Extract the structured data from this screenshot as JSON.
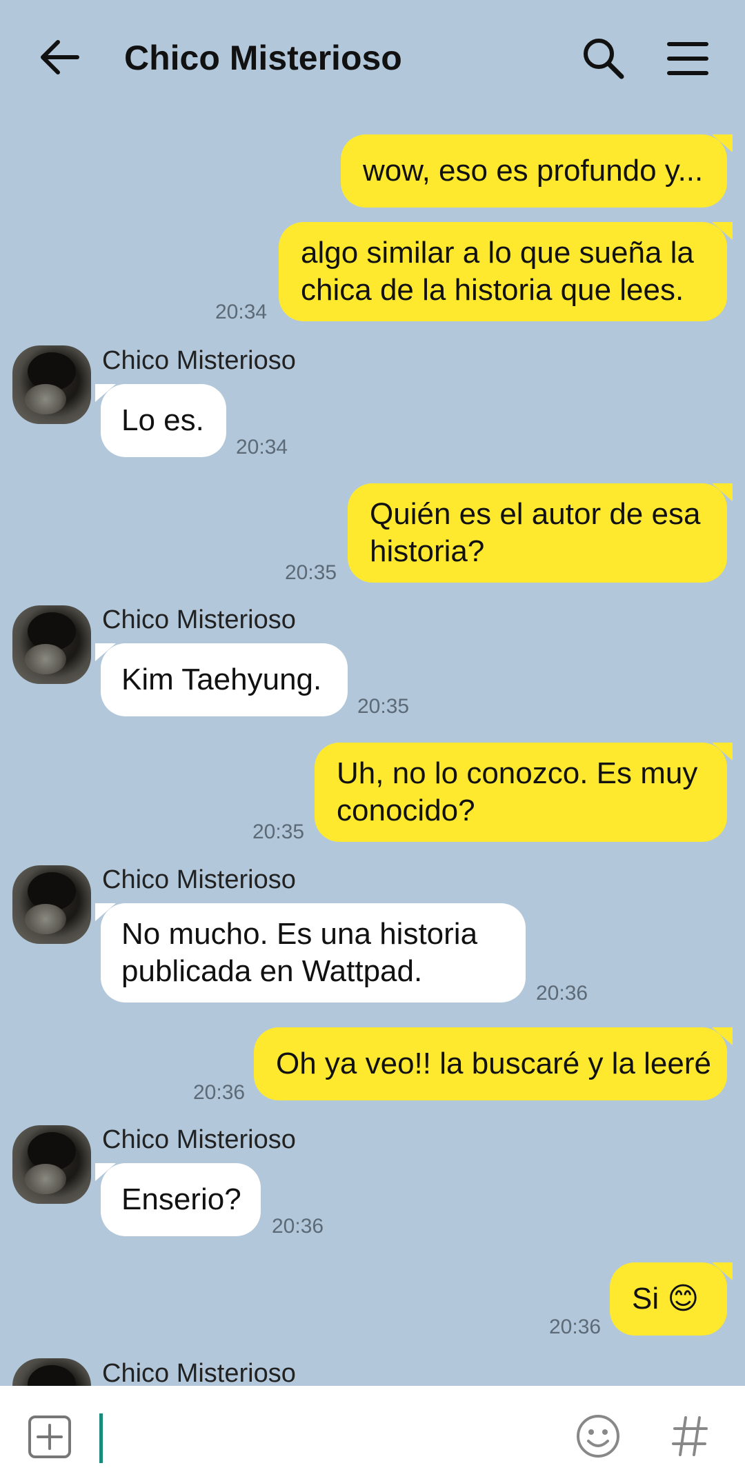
{
  "header": {
    "title": "Chico Misterioso"
  },
  "messages": [
    {
      "side": "out",
      "lines": [
        "wow, eso es profundo y..."
      ],
      "time": ""
    },
    {
      "side": "out",
      "lines": [
        "algo similar a lo que sueña la",
        "chica de la historia que lees."
      ],
      "time": "20:34"
    },
    {
      "side": "in",
      "sender": "Chico Misterioso",
      "lines": [
        "Lo es."
      ],
      "time": "20:34"
    },
    {
      "side": "out",
      "lines": [
        "Quién es el autor de esa",
        "historia?"
      ],
      "time": "20:35"
    },
    {
      "side": "in",
      "sender": "Chico Misterioso",
      "lines": [
        "Kim Taehyung."
      ],
      "time": "20:35"
    },
    {
      "side": "out",
      "lines": [
        "Uh, no lo conozco. Es muy",
        "conocido?"
      ],
      "time": "20:35"
    },
    {
      "side": "in",
      "sender": "Chico Misterioso",
      "lines": [
        "No mucho. Es una historia",
        "publicada en Wattpad."
      ],
      "time": "20:36"
    },
    {
      "side": "out",
      "lines": [
        "Oh ya veo!! la buscaré y la leeré"
      ],
      "time": "20:36"
    },
    {
      "side": "in",
      "sender": "Chico Misterioso",
      "lines": [
        "Enserio?"
      ],
      "time": "20:36"
    },
    {
      "side": "out",
      "lines": [
        "Si 😊"
      ],
      "time": "20:36"
    },
    {
      "side": "in",
      "sender": "Chico Misterioso",
      "lines": [],
      "time": ""
    }
  ],
  "composer": {
    "value": "",
    "placeholder": ""
  },
  "icons": {
    "back": "arrow-left-icon",
    "search": "search-icon",
    "menu": "hamburger-menu-icon",
    "plus": "plus-square-icon",
    "emoji": "smiley-icon",
    "hashtag": "hashtag-icon"
  },
  "colors": {
    "background": "#b2c7da",
    "outgoing_bubble": "#fee92e",
    "incoming_bubble": "#ffffff",
    "cursor": "#1a8a7a"
  }
}
